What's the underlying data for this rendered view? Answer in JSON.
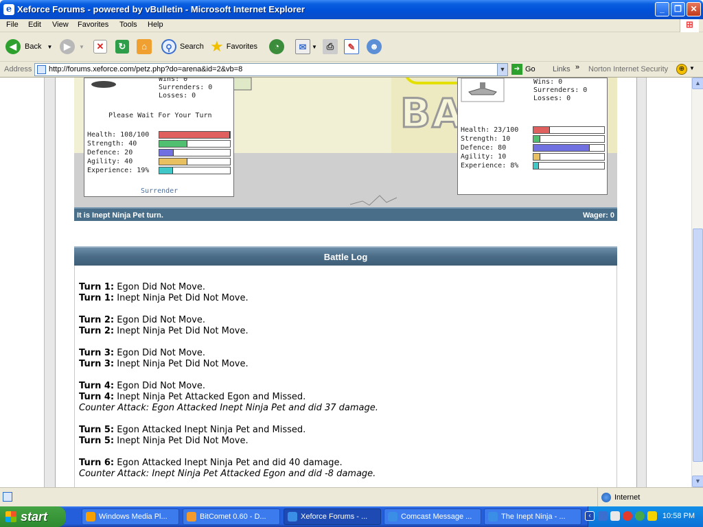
{
  "window": {
    "title": "Xeforce Forums - powered by vBulletin - Microsoft Internet Explorer",
    "minimize": "_",
    "maximize": "❐",
    "close": "✕"
  },
  "menu": [
    "File",
    "Edit",
    "View",
    "Favorites",
    "Tools",
    "Help"
  ],
  "toolbar": {
    "back": "Back",
    "search": "Search",
    "favorites": "Favorites"
  },
  "address": {
    "label": "Address",
    "url": "http://forums.xeforce.com/petz.php?do=arena&id=2&vb=8",
    "go": "Go",
    "links": "Links",
    "norton": "Norton Internet Security"
  },
  "arena": {
    "graffiti": "BATTLE",
    "player": {
      "top_lines": [
        "Wins: 0",
        "Surrenders: 0",
        "Losses: 0"
      ],
      "wait_text": "Please Wait For Your Turn",
      "stats": [
        {
          "label": "Health: 108/100",
          "fraction": 1.0,
          "color": "#e06060"
        },
        {
          "label": "Strength: 40",
          "fraction": 0.4,
          "color": "#50c070"
        },
        {
          "label": "Defence: 20",
          "fraction": 0.2,
          "color": "#7070e0"
        },
        {
          "label": "Agility: 40",
          "fraction": 0.4,
          "color": "#e8c060"
        },
        {
          "label": "Experience: 19%",
          "fraction": 0.19,
          "color": "#40c8c8"
        }
      ],
      "surrender": "Surrender"
    },
    "opponent": {
      "top_lines": [
        "Wins: 0",
        "Surrenders: 0",
        "Losses: 0"
      ],
      "stats": [
        {
          "label": "Health: 23/100",
          "fraction": 0.23,
          "color": "#e06060"
        },
        {
          "label": "Strength: 10",
          "fraction": 0.1,
          "color": "#50c070"
        },
        {
          "label": "Defence: 80",
          "fraction": 0.8,
          "color": "#7070e0"
        },
        {
          "label": "Agility: 10",
          "fraction": 0.1,
          "color": "#e8c060"
        },
        {
          "label": "Experience: 8%",
          "fraction": 0.08,
          "color": "#40c8c8"
        }
      ]
    },
    "turn_text": "It is Inept Ninja Pet turn.",
    "wager_text": "Wager: 0"
  },
  "battle_log": {
    "title": "Battle Log",
    "groups": [
      [
        {
          "turn": "Turn 1:",
          "text": " Egon Did Not Move."
        },
        {
          "turn": "Turn 1:",
          "text": " Inept Ninja Pet Did Not Move."
        }
      ],
      [
        {
          "turn": "Turn 2:",
          "text": " Egon Did Not Move."
        },
        {
          "turn": "Turn 2:",
          "text": " Inept Ninja Pet Did Not Move."
        }
      ],
      [
        {
          "turn": "Turn 3:",
          "text": " Egon Did Not Move."
        },
        {
          "turn": "Turn 3:",
          "text": " Inept Ninja Pet Did Not Move."
        }
      ],
      [
        {
          "turn": "Turn 4:",
          "text": " Egon Did Not Move."
        },
        {
          "turn": "Turn 4:",
          "text": " Inept Ninja Pet Attacked Egon and Missed."
        },
        {
          "counter": "Counter Attack: Egon Attacked Inept Ninja Pet and did 37 damage."
        }
      ],
      [
        {
          "turn": "Turn 5:",
          "text": " Egon Attacked Inept Ninja Pet and Missed."
        },
        {
          "turn": "Turn 5:",
          "text": " Inept Ninja Pet Did Not Move."
        }
      ],
      [
        {
          "turn": "Turn 6:",
          "text": " Egon Attacked Inept Ninja Pet and did 40 damage."
        },
        {
          "counter": "Counter Attack: Inept Ninja Pet Attacked Egon and did -8 damage."
        }
      ]
    ]
  },
  "statusbar": {
    "zone": "Internet"
  },
  "taskbar": {
    "start": "start",
    "tasks": [
      {
        "label": "Windows Media Pl...",
        "icon_color": "#f5a000",
        "active": false
      },
      {
        "label": "BitComet 0.60 - D...",
        "icon_color": "#f29a2e",
        "active": false
      },
      {
        "label": "Xeforce Forums - ...",
        "icon_color": "#3a8ee6",
        "active": true
      },
      {
        "label": "Comcast Message ...",
        "icon_color": "#3a8ee6",
        "active": false
      },
      {
        "label": "The Inept Ninja - ...",
        "icon_color": "#3a8ee6",
        "active": false
      }
    ],
    "clock": "10:58 PM"
  },
  "colors": {
    "titlebar": "#0050d8",
    "header_bar": "#486e8a",
    "taskbar": "#245edb",
    "tray": "#0c70d6"
  }
}
